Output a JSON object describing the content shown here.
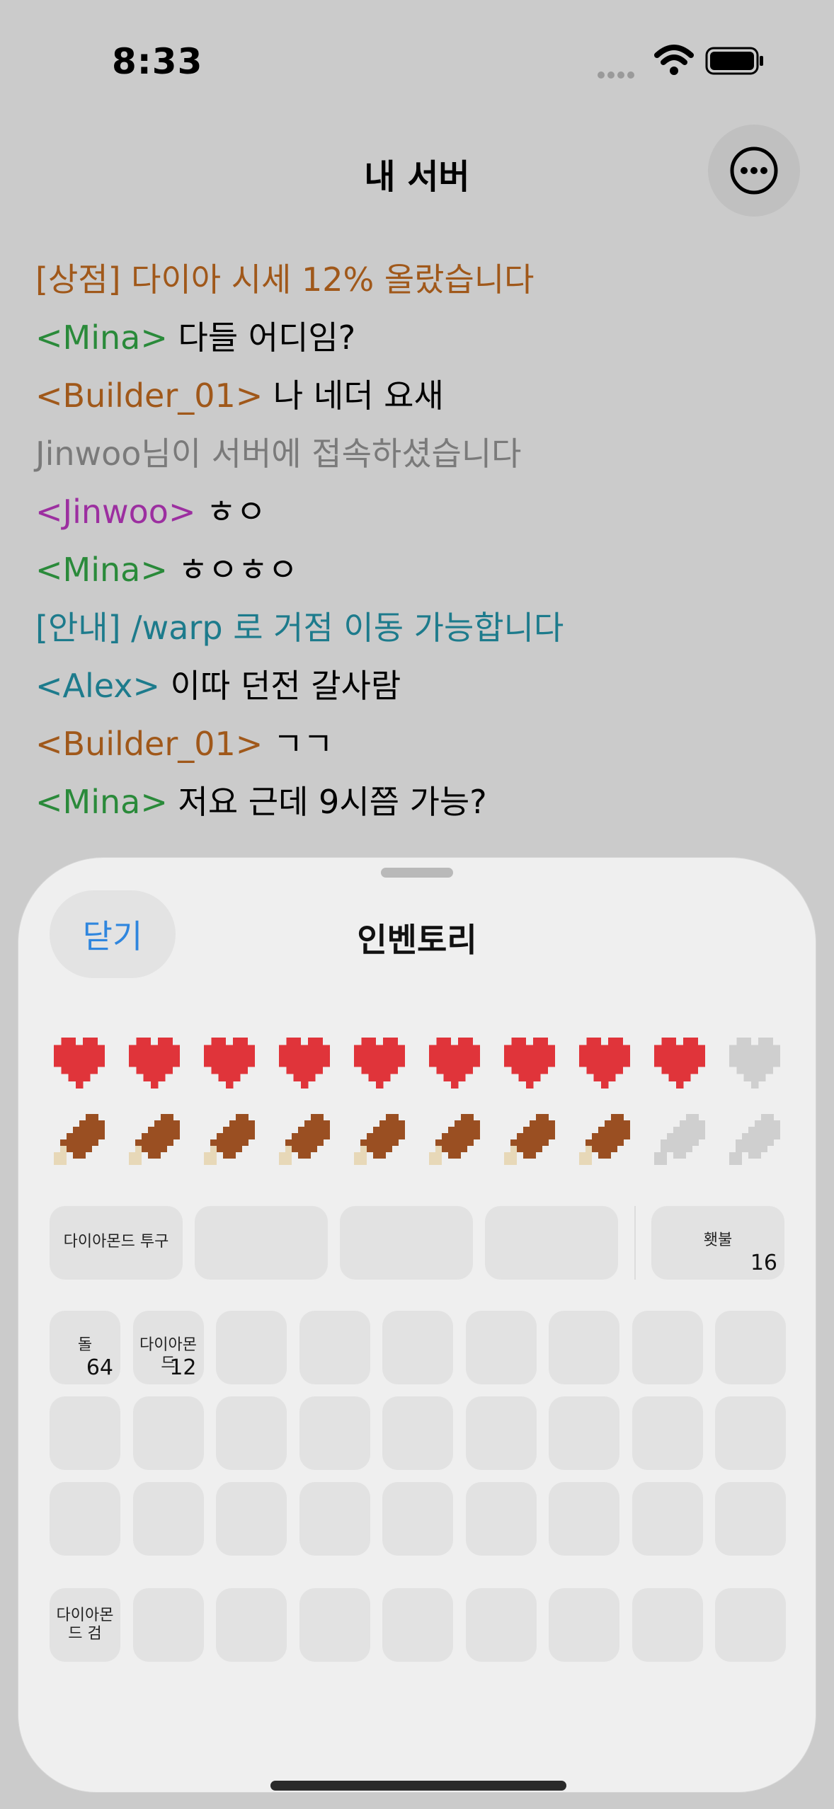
{
  "status_bar": {
    "time": "8:33"
  },
  "nav": {
    "title": "내 서버",
    "more_icon": "ellipsis-circle-icon"
  },
  "chat": [
    {
      "text": "[상점] 다이아 시세 12% 올랐습니다",
      "color": "#a0581a"
    },
    {
      "segments": [
        {
          "text": "<Mina>",
          "color": "#2a8a3a"
        },
        {
          "text": " 다들 어디임?",
          "color": "#000000"
        }
      ]
    },
    {
      "segments": [
        {
          "text": "<Builder_01>",
          "color": "#a0581a"
        },
        {
          "text": " 나 네더 요새",
          "color": "#000000"
        }
      ]
    },
    {
      "text": "Jinwoo님이 서버에 접속하셨습니다",
      "color": "#7a7a7a"
    },
    {
      "segments": [
        {
          "text": "<Jinwoo>",
          "color": "#9c2fa0"
        },
        {
          "text": " ㅎㅇ",
          "color": "#000000"
        }
      ]
    },
    {
      "segments": [
        {
          "text": "<Mina>",
          "color": "#2a8a3a"
        },
        {
          "text": " ㅎㅇㅎㅇ",
          "color": "#000000"
        }
      ]
    },
    {
      "text": "[안내] /warp 로 거점 이동 가능합니다",
      "color": "#1d7b8c"
    },
    {
      "segments": [
        {
          "text": "<Alex>",
          "color": "#1d7b8c"
        },
        {
          "text": " 이따 던전 갈사람",
          "color": "#000000"
        }
      ]
    },
    {
      "segments": [
        {
          "text": "<Builder_01>",
          "color": "#a0581a"
        },
        {
          "text": " ㄱㄱ",
          "color": "#000000"
        }
      ]
    },
    {
      "segments": [
        {
          "text": "<Mina>",
          "color": "#2a8a3a"
        },
        {
          "text": " 저요 근데 9시쯤 가능?",
          "color": "#000000"
        }
      ]
    }
  ],
  "inventory": {
    "close_label": "닫기",
    "title": "인벤토리",
    "hearts": {
      "filled": 9,
      "total": 10
    },
    "hunger": {
      "filled": 8,
      "total": 10
    },
    "armor": [
      {
        "name": "다이아몬드 투구",
        "count": ""
      },
      {
        "name": "",
        "count": ""
      },
      {
        "name": "",
        "count": ""
      },
      {
        "name": "",
        "count": ""
      }
    ],
    "offhand": {
      "name": "횃불",
      "count": "16"
    },
    "main": [
      {
        "name": "돌",
        "count": "64"
      },
      {
        "name": "다이아몬드",
        "count": "12"
      },
      {
        "name": "",
        "count": ""
      },
      {
        "name": "",
        "count": ""
      },
      {
        "name": "",
        "count": ""
      },
      {
        "name": "",
        "count": ""
      },
      {
        "name": "",
        "count": ""
      },
      {
        "name": "",
        "count": ""
      },
      {
        "name": "",
        "count": ""
      },
      {
        "name": "",
        "count": ""
      },
      {
        "name": "",
        "count": ""
      },
      {
        "name": "",
        "count": ""
      },
      {
        "name": "",
        "count": ""
      },
      {
        "name": "",
        "count": ""
      },
      {
        "name": "",
        "count": ""
      },
      {
        "name": "",
        "count": ""
      },
      {
        "name": "",
        "count": ""
      },
      {
        "name": "",
        "count": ""
      },
      {
        "name": "",
        "count": ""
      },
      {
        "name": "",
        "count": ""
      },
      {
        "name": "",
        "count": ""
      },
      {
        "name": "",
        "count": ""
      },
      {
        "name": "",
        "count": ""
      },
      {
        "name": "",
        "count": ""
      },
      {
        "name": "",
        "count": ""
      },
      {
        "name": "",
        "count": ""
      },
      {
        "name": "",
        "count": ""
      }
    ],
    "hotbar": [
      {
        "name": "다이아몬드 검",
        "count": ""
      },
      {
        "name": "",
        "count": ""
      },
      {
        "name": "",
        "count": ""
      },
      {
        "name": "",
        "count": ""
      },
      {
        "name": "",
        "count": ""
      },
      {
        "name": "",
        "count": ""
      },
      {
        "name": "",
        "count": ""
      },
      {
        "name": "",
        "count": ""
      },
      {
        "name": "",
        "count": ""
      }
    ]
  },
  "colors": {
    "heart_full": "#e0343a",
    "heart_empty": "#cfcfcf",
    "drumstick": "#9a4f22",
    "bone": "#e7d8b8",
    "hunger_empty": "#cfcfcf",
    "accent": "#2f86de"
  }
}
